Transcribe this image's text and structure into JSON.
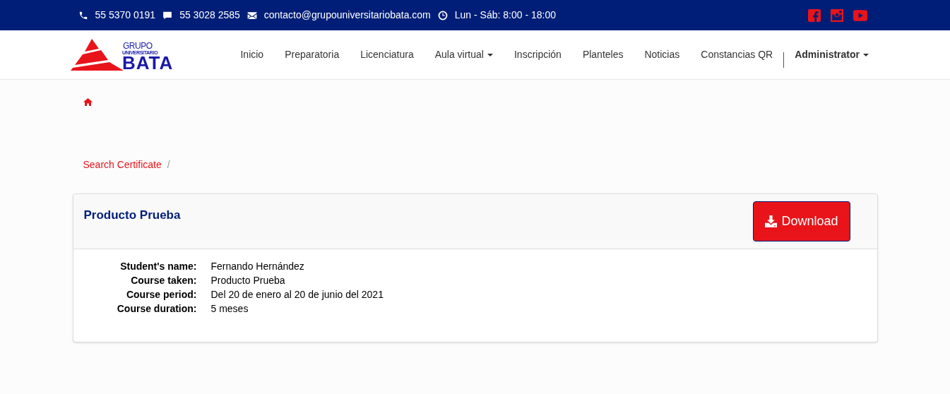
{
  "top_bar": {
    "contacts": [
      {
        "kind": "phone",
        "text": "55 5370 0191"
      },
      {
        "kind": "chat",
        "text": "55 3028 2585"
      },
      {
        "kind": "mail",
        "text": "contacto@grupouniversitariobata.com"
      },
      {
        "kind": "clock",
        "text": "Lun - Sáb: 8:00 - 18:00"
      }
    ],
    "social": [
      {
        "kind": "facebook"
      },
      {
        "kind": "instagram"
      },
      {
        "kind": "youtube"
      }
    ]
  },
  "logo": {
    "line_1": "GRUPO",
    "line_2": "UNIVERSITARIO",
    "line_3": "BATA"
  },
  "nav": {
    "items": [
      {
        "label": "Inicio",
        "dropdown": false
      },
      {
        "label": "Preparatoria",
        "dropdown": false
      },
      {
        "label": "Licenciatura",
        "dropdown": false
      },
      {
        "label": "Aula virtual",
        "dropdown": true
      },
      {
        "label": "Inscripción",
        "dropdown": false
      },
      {
        "label": "Planteles",
        "dropdown": false
      },
      {
        "label": "Noticias",
        "dropdown": false
      },
      {
        "label": "Constancias QR",
        "dropdown": false
      }
    ],
    "user_menu": {
      "label": "Administrator",
      "dropdown": true
    }
  },
  "breadcrumb": {
    "items": [
      "Search Certificate"
    ],
    "separator": "/"
  },
  "card": {
    "title": "Producto Prueba",
    "button": "Download",
    "fields": [
      {
        "label": "Student's name:",
        "value": "Fernando Hernández"
      },
      {
        "label": "Course taken:",
        "value": "Producto Prueba"
      },
      {
        "label": "Course period:",
        "value": "Del 20 de enero al 20 de junio del 2021"
      },
      {
        "label": "Course duration:",
        "value": "5 meses"
      }
    ]
  }
}
